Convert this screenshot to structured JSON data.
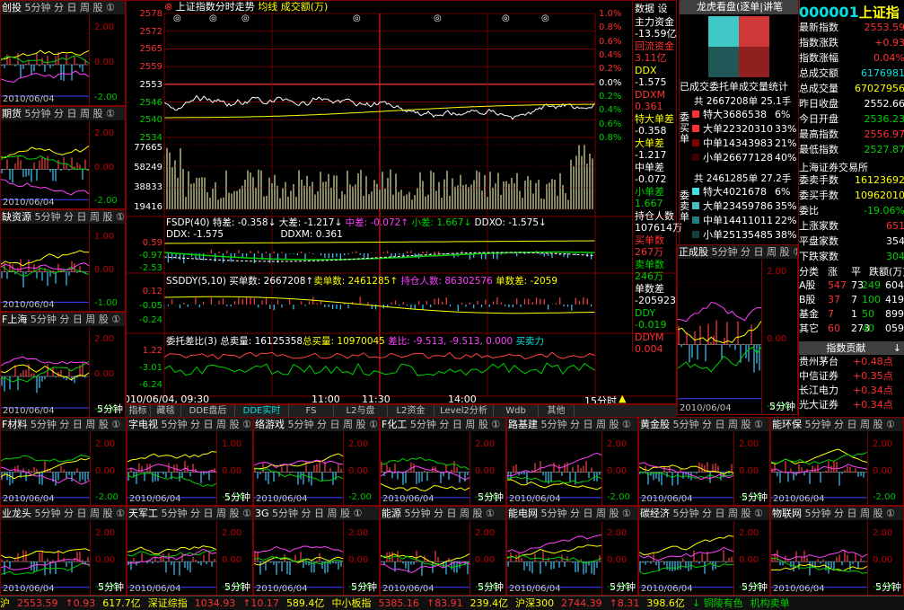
{
  "colors": {
    "up": "#ff3030",
    "down": "#00d000",
    "bg": "#000000",
    "grid": "#800000",
    "accent": "#ffff00",
    "cyan": "#00e0e0"
  },
  "small_panels": [
    {
      "title": "创投",
      "suffix": "5分钟 分 日 周 股 ①",
      "date": "2010/06/04",
      "ticks": [
        "2.00",
        "0.00",
        "-2.00"
      ]
    },
    {
      "title": "期货",
      "suffix": "5分钟 分 日 周 股 ①",
      "date": "2010/06/04",
      "ticks": [
        "2.00",
        "0.00",
        "-2.00"
      ]
    },
    {
      "title": "缺资源",
      "suffix": "5分钟 分 日 周 股 ①",
      "date": "2010/06/04",
      "ticks": [
        "1.00",
        "0.00",
        "-1.00"
      ]
    },
    {
      "title": "F上海",
      "suffix": "5分钟 分 日 周 股 ①",
      "date": "2010/06/04",
      "ticks": [
        "2.00",
        "0.00",
        "-2.00"
      ],
      "min_label": "5分钟"
    },
    {
      "title": "正成股",
      "suffix": "5分钟 分 日 周 股 ①",
      "date": "2010/06/04",
      "ticks": [
        "2.00",
        "0.00",
        "-2.00"
      ],
      "min_label": "5分钟"
    }
  ],
  "bottom_panels_row1": [
    {
      "title": "F材料",
      "suffix": "5分钟 分 日 周 股 ①",
      "date": "2010/06/04",
      "ticks": [
        "2.00",
        "0.00",
        "-2.00"
      ]
    },
    {
      "title": "字电视",
      "suffix": "5分钟 分 日 周 股 ①",
      "date": "2010/06/04",
      "ticks": [
        "1.00",
        "0.00",
        "-1.00"
      ],
      "min_label": "5分钟"
    },
    {
      "title": "络游戏",
      "suffix": "5分钟 分 日 周 股 ①",
      "date": "2010/06/04",
      "ticks": [
        "2.00",
        "0.00",
        "-2.00"
      ]
    },
    {
      "title": "F化工",
      "suffix": "5分钟 分 日 周 股 ①",
      "date": "2010/06/04",
      "ticks": [
        "2.00",
        "0.00",
        "-2.00"
      ],
      "min_label": "5分钟"
    },
    {
      "title": "路基建",
      "suffix": "5分钟 分 日 周 股 ①",
      "date": "2010/06/04",
      "ticks": [
        "2.00",
        "0.00",
        "-2.00"
      ]
    },
    {
      "title": "黄金股",
      "suffix": "5分钟 分 日 周 股 ①",
      "date": "2010/06/04",
      "ticks": [
        "2.00",
        "0.00",
        "-2.00"
      ],
      "min_label": "5分钟"
    },
    {
      "title": "能环保",
      "suffix": "5分钟 分 日 周 股 ①",
      "date": "2010/06/04",
      "ticks": [
        "2.00",
        "0.00",
        "-2.00"
      ]
    }
  ],
  "bottom_panels_row2": [
    {
      "title": "业龙头",
      "suffix": "5分钟 分 日 周 股 ①",
      "date": "2010/06/04",
      "ticks": [
        "2.00",
        "0.00",
        "-2.00"
      ],
      "min_label": "5分钟"
    },
    {
      "title": "天军工",
      "suffix": "5分钟 分 日 周 股 ①",
      "date": "2010/06/04",
      "ticks": [
        "2.00",
        "0.00",
        "-2.00"
      ],
      "min_label": "5分钟"
    },
    {
      "title": "3G",
      "suffix": "5分钟 分 日 周 股 ①",
      "date": "2010/06/04",
      "ticks": [
        "2.00",
        "0.00",
        "-2.00"
      ],
      "min_label": "5分钟"
    },
    {
      "title": "能源",
      "suffix": "5分钟 分 日 周 股 ①",
      "date": "2010/06/04",
      "ticks": [
        "2.00",
        "0.00",
        "-2.00"
      ],
      "min_label": "5分钟"
    },
    {
      "title": "能电网",
      "suffix": "5分钟 分 日 周 股 ①",
      "date": "2010/06/04",
      "ticks": [
        "2.00",
        "0.00",
        "-2.00"
      ],
      "min_label": "5分钟"
    },
    {
      "title": "碳经济",
      "suffix": "5分钟 分 日 周 股 ①",
      "date": "2010/06/04",
      "ticks": [
        "2.00",
        "0.00",
        "-2.00"
      ],
      "min_label": "5分钟"
    },
    {
      "title": "物联网",
      "suffix": "5分钟 分 日 周 股 ①",
      "date": "2010/06/04",
      "ticks": [
        "2.00",
        "0.00",
        "-2.00"
      ],
      "min_label": "5分钟"
    }
  ],
  "main": {
    "title": "上证指数分时走势",
    "avg_line": "均线",
    "volume": "成交额(万)",
    "price_ticks": [
      "2578",
      "2572",
      "2565",
      "2559",
      "2553",
      "2546",
      "2540",
      "2534"
    ],
    "pct_ticks": [
      "1.0%",
      "0.8%",
      "0.6%",
      "0.4%",
      "0.2%",
      "0.0%",
      "0.2%",
      "0.4%",
      "0.6%",
      "0.8%"
    ],
    "vol_ticks": [
      "77665",
      "58249",
      "38833",
      "19416"
    ],
    "fsdp": {
      "name": "FSDP(40)",
      "te": "特差: -0.358↓",
      "da": "大差: -1.217↓",
      "zhong": "中差: -0.072↑",
      "xiao": "小差: 1.667↓",
      "ddx0": "DDXO: -1.575↓",
      "ddx": "DDX: -1.575",
      "ddxm": "DDXM: 0.361",
      "ticks": [
        "0.59",
        "-0.97",
        "-2.53"
      ]
    },
    "ssddy": {
      "name": "SSDDY(5,10)",
      "buy": "买单数: 2667208↑",
      "sell": "卖单数: 2461285↑",
      "hold": "持仓人数: 86302576",
      "diff": "单数差: -2059",
      "ticks": [
        "0.12",
        "-0.05",
        "-0.24"
      ]
    },
    "wtb": {
      "name": "委托差比(3)",
      "total_sell": "总卖量: 16125358",
      "total_buy": "总买量: 10970045",
      "ratio": "差比: -9.513, -9.513, 0.000",
      "buysell": "买卖力",
      "ticks": [
        "1.22",
        "-3.01",
        "-6.24"
      ]
    },
    "time_labels": [
      "2010/06/04, 09:30",
      "11:00",
      "11:30",
      "14:00",
      "15分时"
    ],
    "tabs": [
      "指标",
      "藏毯",
      "DDE盘后",
      "DDE实时",
      "FS",
      "L2与盘",
      "L2资金",
      "Level2分析",
      "Wdb",
      "其他"
    ]
  },
  "data_panel": {
    "header": "数据 设",
    "items": [
      {
        "label": "主力资金",
        "value": "-13.59亿",
        "lc": "white",
        "vc": "white"
      },
      {
        "label": "回流资金",
        "value": "3.11亿",
        "lc": "red",
        "vc": "red"
      },
      {
        "label": "DDX",
        "value": "-1.575",
        "lc": "yellow",
        "vc": "white"
      },
      {
        "label": "DDXM",
        "value": "0.361",
        "lc": "red",
        "vc": "red"
      },
      {
        "label": "特大单差",
        "value": "-0.358",
        "lc": "yellow",
        "vc": "white"
      },
      {
        "label": "大单差",
        "value": "-1.217",
        "lc": "yellow",
        "vc": "white"
      },
      {
        "label": "中单差",
        "value": "-0.072",
        "lc": "white",
        "vc": "white"
      },
      {
        "label": "小单差",
        "value": "1.667",
        "lc": "green",
        "vc": "green"
      },
      {
        "label": "持仓人数",
        "value": "107614万",
        "lc": "white",
        "vc": "white"
      },
      {
        "label": "买单数",
        "value": "267万",
        "lc": "red",
        "vc": "red"
      },
      {
        "label": "卖单数",
        "value": "246万",
        "lc": "green",
        "vc": "green"
      },
      {
        "label": "单数差",
        "value": "-205923",
        "lc": "white",
        "vc": "white"
      },
      {
        "label": "DDY",
        "value": "-0.019",
        "lc": "green",
        "vc": "green"
      },
      {
        "label": "DDYM",
        "value": "0.004",
        "lc": "red",
        "vc": "red"
      }
    ]
  },
  "dragon": {
    "header": "龙虎看盘(逐单|讲笔",
    "caption": "已成交委托单成交量统计",
    "buy_total": "共 2667208单 25.1手",
    "buy_rows": [
      {
        "label": "特大",
        "count": "3686538",
        "pct": "6%"
      },
      {
        "label": "大单",
        "count": "22320310",
        "pct": "33%"
      },
      {
        "label": "中单",
        "count": "14343983",
        "pct": "21%"
      },
      {
        "label": "小单",
        "count": "26677128",
        "pct": "40%"
      }
    ],
    "sell_total": "共 2461285单 27.2手",
    "sell_rows": [
      {
        "label": "特大",
        "count": "4021678",
        "pct": "6%"
      },
      {
        "label": "大单",
        "count": "23459786",
        "pct": "35%"
      },
      {
        "label": "中单",
        "count": "14411011",
        "pct": "22%"
      },
      {
        "label": "小单",
        "count": "25135485",
        "pct": "38%"
      }
    ],
    "buy_side": "委买单",
    "sell_side": "委卖单"
  },
  "quote": {
    "code": "000001",
    "name": "上证指",
    "rows": [
      {
        "label": "最新指数",
        "value": "2553.59",
        "vc": "red"
      },
      {
        "label": "指数涨跌",
        "value": "+0.93",
        "vc": "red"
      },
      {
        "label": "指数涨幅",
        "value": "0.04%",
        "vc": "red"
      },
      {
        "label": "总成交额",
        "value": "6176981",
        "vc": "cyan"
      },
      {
        "label": "总成交量",
        "value": "67027956",
        "vc": "yellow"
      },
      {
        "label": "昨日收盘",
        "value": "2552.66",
        "vc": "white"
      },
      {
        "label": "今日开盘",
        "value": "2536.23",
        "vc": "green"
      },
      {
        "label": "最高指数",
        "value": "2556.97",
        "vc": "red"
      },
      {
        "label": "最低指数",
        "value": "2527.87",
        "vc": "green"
      }
    ],
    "exchange": "上海证券交易所",
    "rows2": [
      {
        "label": "委卖手数",
        "value": "16123692",
        "vc": "yellow"
      },
      {
        "label": "委买手数",
        "value": "10962010",
        "vc": "yellow"
      },
      {
        "label": "委比",
        "value": "-19.06%",
        "vc": "green"
      },
      {
        "label": "上涨家数",
        "value": "651",
        "vc": "red"
      },
      {
        "label": "平盘家数",
        "value": "354",
        "vc": "white"
      },
      {
        "label": "下跌家数",
        "value": "304",
        "vc": "green"
      }
    ],
    "table_header": [
      "分类",
      "涨",
      "平",
      "跌额(万)"
    ],
    "table": [
      {
        "cat": "A股",
        "up": "547",
        "flat": "73",
        "down": "249",
        "amt": "604"
      },
      {
        "cat": "B股",
        "up": "37",
        "flat": "7",
        "down": "100",
        "amt": "419"
      },
      {
        "cat": "基金",
        "up": "7",
        "flat": "1",
        "down": "50",
        "amt": "899"
      },
      {
        "cat": "其它",
        "up": "60",
        "flat": "273",
        "down": "40",
        "amt": "059"
      }
    ],
    "contrib_title": "指数贡献",
    "contrib": [
      {
        "name": "贵州茅台",
        "value": "+0.48点"
      },
      {
        "name": "中信证券",
        "value": "+0.35点"
      },
      {
        "name": "长江电力",
        "value": "+0.34点"
      },
      {
        "name": "光大证券",
        "value": "+0.34点"
      }
    ]
  },
  "status_bar": [
    {
      "text": "沪",
      "c": "yellow"
    },
    {
      "text": "2553.59",
      "c": "red"
    },
    {
      "text": "↑0.93",
      "c": "red"
    },
    {
      "text": "617.7亿",
      "c": "yellow"
    },
    {
      "text": "深证综指",
      "c": "yellow"
    },
    {
      "text": "1034.93",
      "c": "red"
    },
    {
      "text": "↑10.17",
      "c": "red"
    },
    {
      "text": "589.4亿",
      "c": "yellow"
    },
    {
      "text": "中小板指",
      "c": "yellow"
    },
    {
      "text": "5385.16",
      "c": "red"
    },
    {
      "text": "↑83.91",
      "c": "red"
    },
    {
      "text": "239.4亿",
      "c": "yellow"
    },
    {
      "text": "沪深300",
      "c": "yellow"
    },
    {
      "text": "2744.39",
      "c": "red"
    },
    {
      "text": "↑8.31",
      "c": "red"
    },
    {
      "text": "398.6亿",
      "c": "yellow"
    },
    {
      "text": "↓ 铜陵有色",
      "c": "green"
    },
    {
      "text": "机构卖单",
      "c": "green"
    }
  ]
}
